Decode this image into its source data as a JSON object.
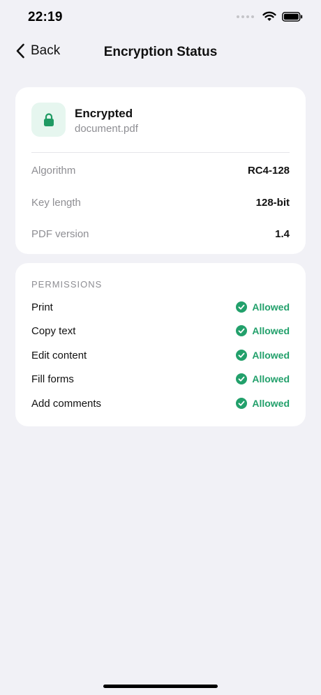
{
  "status_bar": {
    "time": "22:19",
    "icons": [
      "signal-dots-icon",
      "wifi-icon",
      "battery-icon"
    ]
  },
  "nav": {
    "back_label": "Back",
    "back_icon": "chevron-left-icon",
    "title": "Encryption Status"
  },
  "summary": {
    "icon": "lock-icon",
    "status": "Encrypted",
    "file_name": "document.pdf",
    "details": [
      {
        "label": "Algorithm",
        "value": "RC4-128"
      },
      {
        "label": "Key length",
        "value": "128-bit"
      },
      {
        "label": "PDF version",
        "value": "1.4"
      }
    ]
  },
  "permissions": {
    "section_title": "PERMISSIONS",
    "items": [
      {
        "label": "Print",
        "status": "Allowed"
      },
      {
        "label": "Copy text",
        "status": "Allowed"
      },
      {
        "label": "Edit content",
        "status": "Allowed"
      },
      {
        "label": "Fill forms",
        "status": "Allowed"
      },
      {
        "label": "Add comments",
        "status": "Allowed"
      }
    ]
  },
  "colors": {
    "background": "#f1f1f6",
    "card": "#ffffff",
    "accent_green": "#22a06b",
    "lock_tile": "#e6f6ef",
    "secondary_text": "#8e8e93"
  }
}
